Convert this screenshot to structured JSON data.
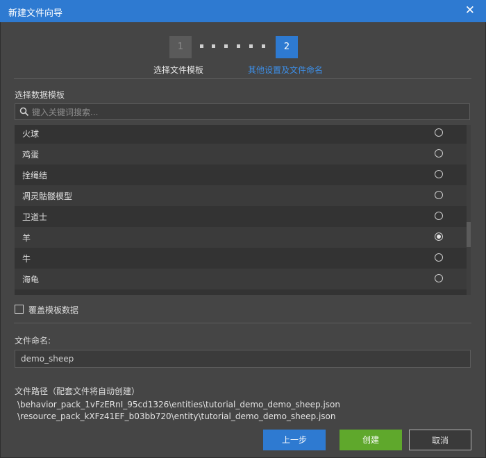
{
  "window": {
    "title": "新建文件向导",
    "close_glyph": "✕"
  },
  "stepper": {
    "steps": [
      {
        "number": "1",
        "label": "选择文件模板",
        "state": "inactive"
      },
      {
        "number": "2",
        "label": "其他设置及文件命名",
        "state": "active"
      }
    ]
  },
  "template_section": {
    "label": "选择数据模板",
    "search_placeholder": "键入关键词搜索...",
    "items": [
      {
        "label": "火球",
        "selected": false
      },
      {
        "label": "鸡蛋",
        "selected": false
      },
      {
        "label": "拴绳结",
        "selected": false
      },
      {
        "label": "凋灵骷髅模型",
        "selected": false
      },
      {
        "label": "卫道士",
        "selected": false
      },
      {
        "label": "羊",
        "selected": true
      },
      {
        "label": "牛",
        "selected": false
      },
      {
        "label": "海龟",
        "selected": false
      }
    ]
  },
  "override_checkbox": {
    "label": "覆盖模板数据",
    "checked": false
  },
  "file_name": {
    "label": "文件命名:",
    "value": "demo_sheep"
  },
  "file_path": {
    "label": "文件路径（配套文件将自动创建）",
    "paths": [
      "\\behavior_pack_1vFzERnI_95cd1326\\entities\\tutorial_demo_demo_sheep.json",
      "\\resource_pack_kXFz41EF_b03bb720\\entity\\tutorial_demo_demo_sheep.json"
    ]
  },
  "buttons": {
    "prev": "上一步",
    "create": "创建",
    "cancel": "取消"
  },
  "colors": {
    "accent": "#2e7ad1",
    "create": "#5fa82c",
    "background": "#454545"
  }
}
